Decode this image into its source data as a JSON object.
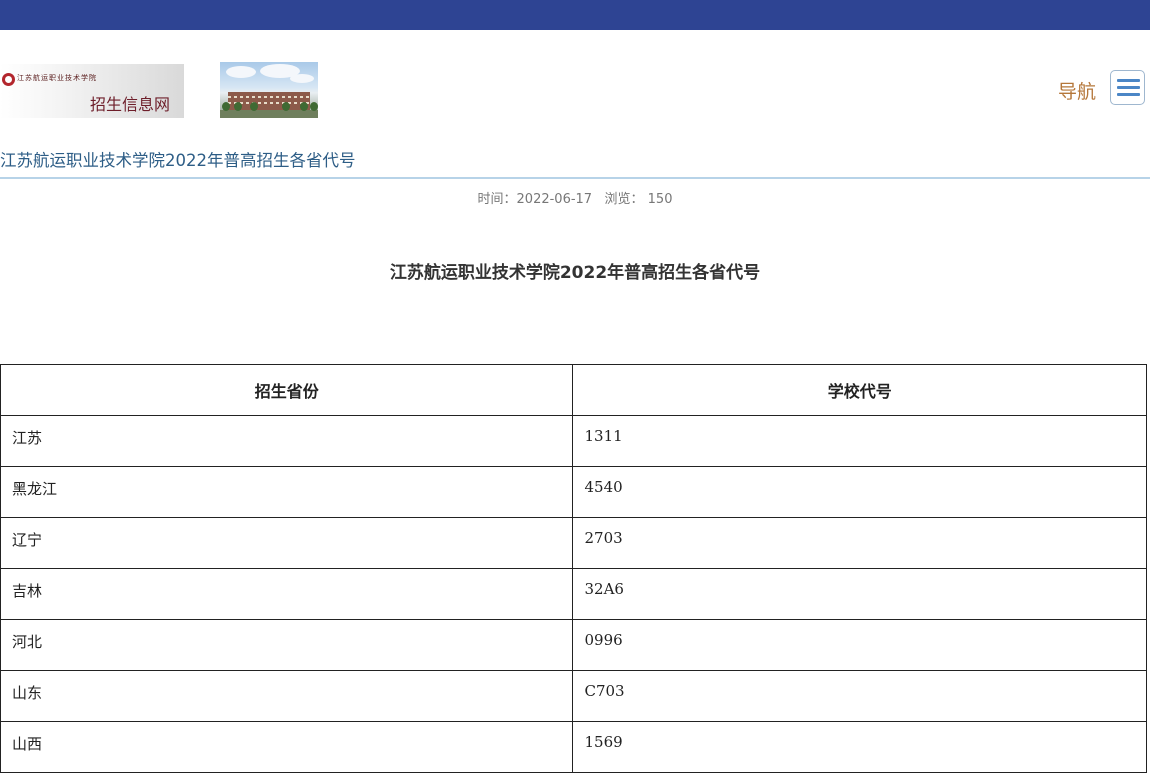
{
  "header": {
    "logo_school_name": "江苏航运职业技术学院",
    "logo_site_name": "招生信息网",
    "nav_label": "导航",
    "accent_color": "#2e4493"
  },
  "page_heading": "江苏航运职业技术学院2022年普高招生各省代号",
  "meta": {
    "time_label": "时间：",
    "time_value": "2022-06-17",
    "views_label": "浏览：",
    "views_value": "150"
  },
  "article_title": "江苏航运职业技术学院2022年普高招生各省代号",
  "table": {
    "headers": [
      "招生省份",
      "学校代号"
    ],
    "rows": [
      [
        "江苏",
        "1311"
      ],
      [
        "黑龙江",
        "4540"
      ],
      [
        "辽宁",
        "2703"
      ],
      [
        "吉林",
        "32A6"
      ],
      [
        "河北",
        "0996"
      ],
      [
        "山东",
        "C703"
      ],
      [
        "山西",
        "1569"
      ]
    ]
  }
}
